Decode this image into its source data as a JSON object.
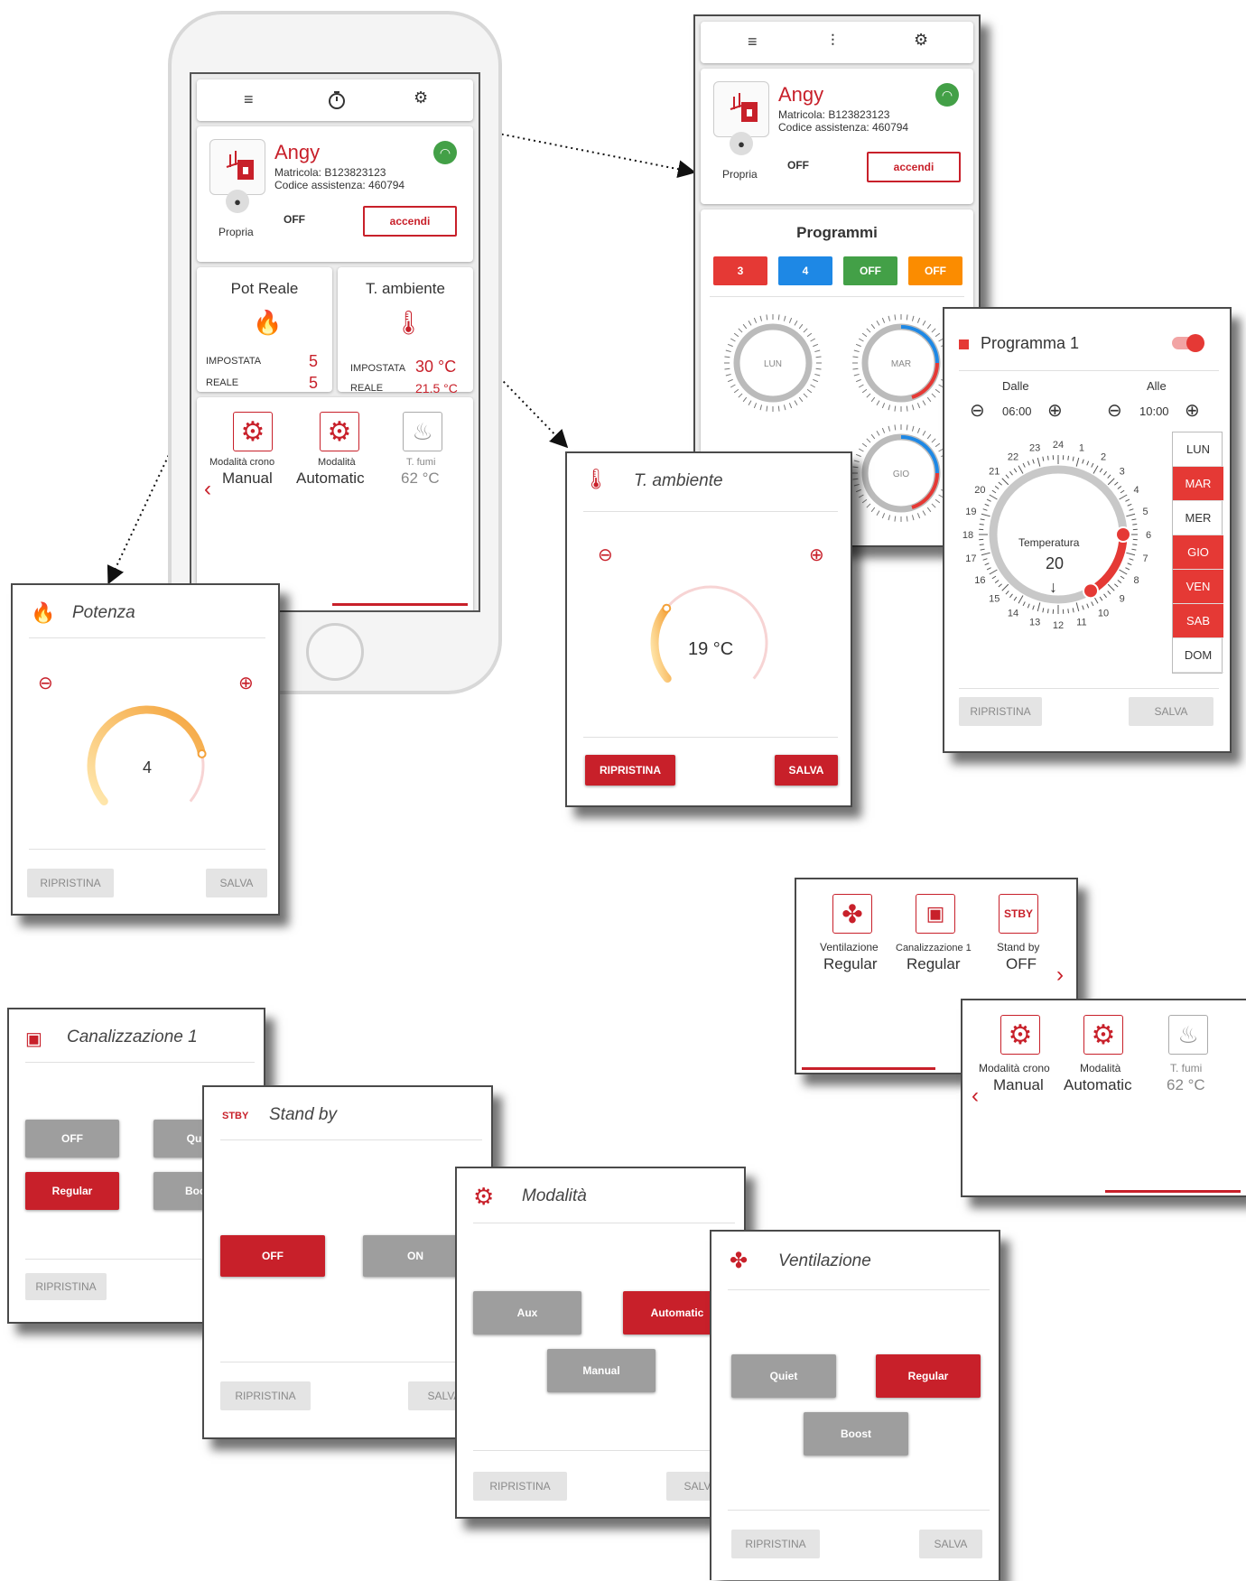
{
  "toolbar": {
    "list_icon": "list-icon",
    "timer_icon": "timer-icon",
    "settings_icon": "gear-icon",
    "sliders_icon": "sliders-icon"
  },
  "device": {
    "name": "Angy",
    "matricola": "Matricola: B123823123",
    "codice": "Codice assistenza: 460794",
    "owner": "Propria",
    "state": "OFF",
    "action": "accendi"
  },
  "pot_reale": {
    "title": "Pot Reale",
    "impostata_label": "IMPOSTATA",
    "impostata_value": "5",
    "reale_label": "REALE",
    "reale_value": "5"
  },
  "t_ambiente": {
    "title": "T. ambiente",
    "impostata_label": "IMPOSTATA",
    "impostata_value": "30 °C",
    "reale_label": "REALE",
    "reale_value": "21.5 °C"
  },
  "modes_row": {
    "crono_label": "Modalità crono",
    "crono_value": "Manual",
    "modalita_label": "Modalità",
    "modalita_value": "Automatic",
    "fumi_label": "T. fumi",
    "fumi_value": "62 °C"
  },
  "programmi": {
    "title": "Programmi",
    "chips": [
      {
        "label": "3",
        "color": "#e53935"
      },
      {
        "label": "4",
        "color": "#1e88e5"
      },
      {
        "label": "OFF",
        "color": "#43a047"
      },
      {
        "label": "OFF",
        "color": "#fb8c00"
      }
    ],
    "dials": [
      "LUN",
      "MAR",
      "GIO"
    ]
  },
  "programma1": {
    "title": "Programma 1",
    "dalle_label": "Dalle",
    "dalle_value": "06:00",
    "alle_label": "Alle",
    "alle_value": "10:00",
    "temp_label": "Temperatura",
    "temp_value": "20",
    "days": [
      "LUN",
      "MAR",
      "MER",
      "GIO",
      "VEN",
      "SAB",
      "DOM"
    ],
    "days_on": [
      false,
      true,
      false,
      true,
      true,
      true,
      false
    ],
    "hours": [
      "24",
      "1",
      "2",
      "3",
      "4",
      "5",
      "6",
      "7",
      "8",
      "9",
      "10",
      "11",
      "12",
      "13",
      "14",
      "15",
      "16",
      "17",
      "18",
      "19",
      "20",
      "21",
      "22",
      "23"
    ],
    "ripristina": "RIPRISTINA",
    "salva": "SALVA"
  },
  "potenza": {
    "title": "Potenza",
    "value": "4",
    "value_fraction": 0.8,
    "ripristina": "RIPRISTINA",
    "salva": "SALVA"
  },
  "t_ambiente_dialog": {
    "title": "T. ambiente",
    "value": "19 °C",
    "ripristina": "RIPRISTINA",
    "salva": "SALVA"
  },
  "ventilation_row": {
    "vent_label": "Ventilazione",
    "vent_value": "Regular",
    "can_label": "Canalizzazione 1",
    "can_value": "Regular",
    "stby_label": "Stand by",
    "stby_value": "OFF",
    "stby_icon": "STBY"
  },
  "canalizzazione": {
    "title": "Canalizzazione 1",
    "off": "OFF",
    "quiet": "Quiet",
    "regular": "Regular",
    "boost": "Boost",
    "ripristina": "RIPRISTINA"
  },
  "standby": {
    "title": "Stand by",
    "badge": "STBY",
    "off": "OFF",
    "on": "ON",
    "ripristina": "RIPRISTINA",
    "salva": "SALVA"
  },
  "modalita": {
    "title": "Modalità",
    "aux": "Aux",
    "automatic": "Automatic",
    "manual": "Manual",
    "ripristina": "RIPRISTINA",
    "salva": "SALVA"
  },
  "ventilazione": {
    "title": "Ventilazione",
    "quiet": "Quiet",
    "regular": "Regular",
    "boost": "Boost",
    "ripristina": "RIPRISTINA",
    "salva": "SALVA"
  }
}
